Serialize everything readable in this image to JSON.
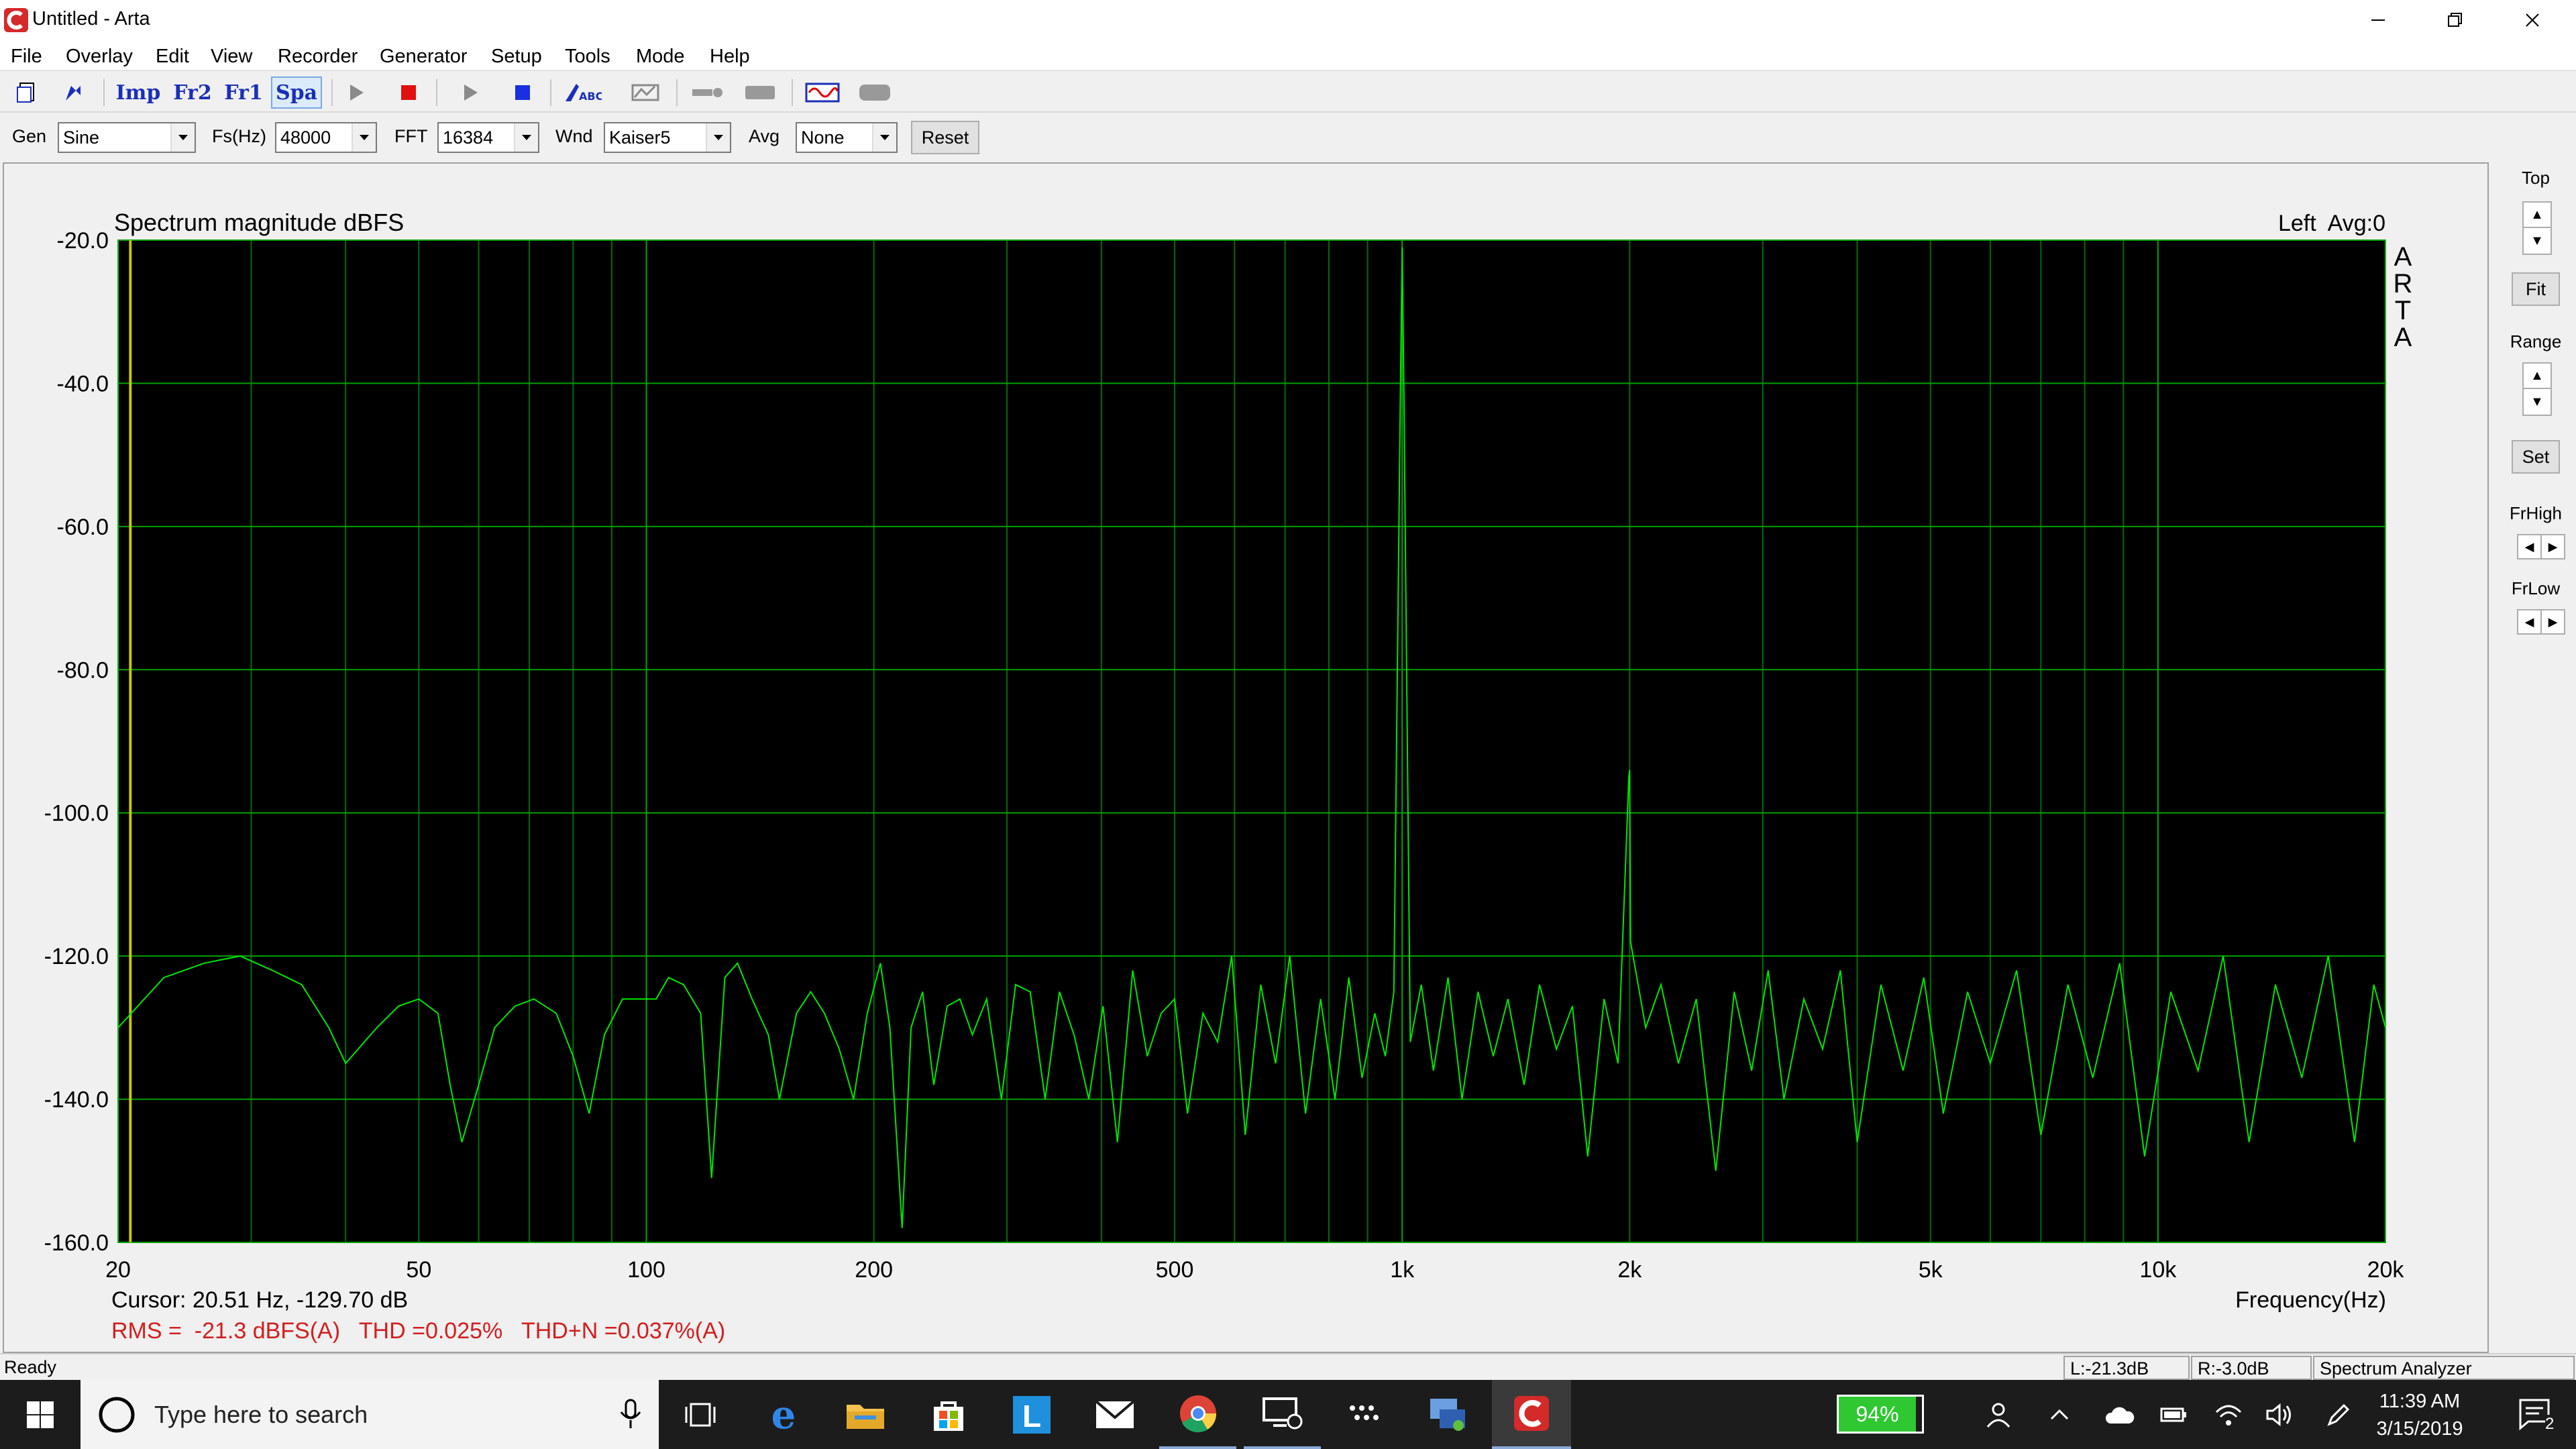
{
  "window": {
    "title": "Untitled - Arta"
  },
  "menu": [
    "File",
    "Overlay",
    "Edit",
    "View",
    "Recorder",
    "Generator",
    "Setup",
    "Tools",
    "Mode",
    "Help"
  ],
  "toolbar": {
    "imp": "Imp",
    "fr2": "Fr2",
    "fr1": "Fr1",
    "spa": "Spa"
  },
  "controls": {
    "gen_label": "Gen",
    "gen_value": "Sine",
    "fs_label": "Fs(Hz)",
    "fs_value": "48000",
    "fft_label": "FFT",
    "fft_value": "16384",
    "wnd_label": "Wnd",
    "wnd_value": "Kaiser5",
    "avg_label": "Avg",
    "avg_value": "None",
    "reset_label": "Reset"
  },
  "side": {
    "top": "Top",
    "fit": "Fit",
    "range": "Range",
    "set": "Set",
    "frhigh": "FrHigh",
    "frlow": "FrLow"
  },
  "plot": {
    "title": "Spectrum magnitude dBFS",
    "channel_info": "Left  Avg:0",
    "brand": [
      "A",
      "R",
      "T",
      "A"
    ],
    "cursor": "Cursor: 20.51 Hz, -129.70 dB",
    "stats": "RMS =  -21.3 dBFS(A)   THD =0.025%   THD+N =0.037%(A)",
    "xlabel": "Frequency(Hz)"
  },
  "chart_data": {
    "type": "line",
    "title": "Spectrum magnitude dBFS",
    "xlabel": "Frequency(Hz)",
    "ylabel": "",
    "x_scale": "log",
    "xlim": [
      20,
      20000
    ],
    "ylim": [
      -160,
      -20
    ],
    "grid": true,
    "x_ticks": [
      20,
      50,
      100,
      200,
      500,
      1000,
      2000,
      5000,
      10000,
      20000
    ],
    "x_tick_labels": [
      "20",
      "50",
      "100",
      "200",
      "500",
      "1k",
      "2k",
      "5k",
      "10k",
      "20k"
    ],
    "y_ticks": [
      -20,
      -40,
      -60,
      -80,
      -100,
      -120,
      -140,
      -160
    ],
    "y_tick_labels": [
      "-20.0",
      "-40.0",
      "-60.0",
      "-80.0",
      "-100.0",
      "-120.0",
      "-140.0",
      "-160.0"
    ],
    "series": [
      {
        "color": "#00e600",
        "points": [
          [
            20,
            -130
          ],
          [
            23,
            -123
          ],
          [
            26,
            -121
          ],
          [
            29,
            -120
          ],
          [
            32,
            -122
          ],
          [
            35,
            -124
          ],
          [
            38,
            -130
          ],
          [
            40,
            -135
          ],
          [
            44,
            -130
          ],
          [
            47,
            -127
          ],
          [
            50,
            -126
          ],
          [
            53,
            -128
          ],
          [
            55,
            -138
          ],
          [
            57,
            -146
          ],
          [
            60,
            -138
          ],
          [
            63,
            -130
          ],
          [
            67,
            -127
          ],
          [
            71,
            -126
          ],
          [
            76,
            -128
          ],
          [
            80,
            -134
          ],
          [
            84,
            -142
          ],
          [
            88,
            -131
          ],
          [
            93,
            -126
          ],
          [
            98,
            -126
          ],
          [
            103,
            -126
          ],
          [
            107,
            -123
          ],
          [
            112,
            -124
          ],
          [
            118,
            -128
          ],
          [
            122,
            -151
          ],
          [
            127,
            -123
          ],
          [
            132,
            -121
          ],
          [
            138,
            -126
          ],
          [
            145,
            -131
          ],
          [
            150,
            -140
          ],
          [
            158,
            -128
          ],
          [
            165,
            -125
          ],
          [
            172,
            -128
          ],
          [
            180,
            -133
          ],
          [
            188,
            -140
          ],
          [
            196,
            -128
          ],
          [
            204,
            -121
          ],
          [
            210,
            -130
          ],
          [
            218,
            -158
          ],
          [
            224,
            -130
          ],
          [
            232,
            -125
          ],
          [
            240,
            -138
          ],
          [
            250,
            -127
          ],
          [
            260,
            -126
          ],
          [
            270,
            -131
          ],
          [
            282,
            -126
          ],
          [
            295,
            -140
          ],
          [
            308,
            -124
          ],
          [
            322,
            -125
          ],
          [
            337,
            -140
          ],
          [
            352,
            -125
          ],
          [
            368,
            -131
          ],
          [
            385,
            -140
          ],
          [
            402,
            -127
          ],
          [
            420,
            -146
          ],
          [
            440,
            -122
          ],
          [
            460,
            -134
          ],
          [
            480,
            -128
          ],
          [
            500,
            -126
          ],
          [
            520,
            -142
          ],
          [
            545,
            -128
          ],
          [
            570,
            -132
          ],
          [
            595,
            -120
          ],
          [
            620,
            -145
          ],
          [
            650,
            -124
          ],
          [
            680,
            -135
          ],
          [
            710,
            -120
          ],
          [
            745,
            -142
          ],
          [
            780,
            -126
          ],
          [
            815,
            -140
          ],
          [
            850,
            -123
          ],
          [
            885,
            -137
          ],
          [
            920,
            -128
          ],
          [
            950,
            -134
          ],
          [
            975,
            -125
          ],
          [
            995,
            -40
          ],
          [
            1000,
            -21
          ],
          [
            1005,
            -40
          ],
          [
            1025,
            -132
          ],
          [
            1060,
            -124
          ],
          [
            1100,
            -136
          ],
          [
            1150,
            -123
          ],
          [
            1200,
            -140
          ],
          [
            1260,
            -125
          ],
          [
            1320,
            -134
          ],
          [
            1380,
            -126
          ],
          [
            1450,
            -138
          ],
          [
            1520,
            -124
          ],
          [
            1600,
            -133
          ],
          [
            1680,
            -127
          ],
          [
            1760,
            -148
          ],
          [
            1850,
            -126
          ],
          [
            1930,
            -135
          ],
          [
            1995,
            -95
          ],
          [
            2000,
            -94
          ],
          [
            2005,
            -118
          ],
          [
            2100,
            -130
          ],
          [
            2200,
            -124
          ],
          [
            2320,
            -135
          ],
          [
            2450,
            -126
          ],
          [
            2600,
            -150
          ],
          [
            2750,
            -125
          ],
          [
            2900,
            -136
          ],
          [
            3050,
            -122
          ],
          [
            3200,
            -140
          ],
          [
            3400,
            -126
          ],
          [
            3600,
            -133
          ],
          [
            3800,
            -122
          ],
          [
            4000,
            -146
          ],
          [
            4300,
            -124
          ],
          [
            4600,
            -136
          ],
          [
            4900,
            -123
          ],
          [
            5200,
            -142
          ],
          [
            5600,
            -125
          ],
          [
            6000,
            -135
          ],
          [
            6500,
            -122
          ],
          [
            7000,
            -145
          ],
          [
            7600,
            -124
          ],
          [
            8200,
            -137
          ],
          [
            8900,
            -121
          ],
          [
            9600,
            -148
          ],
          [
            10400,
            -125
          ],
          [
            11300,
            -136
          ],
          [
            12200,
            -120
          ],
          [
            13200,
            -146
          ],
          [
            14300,
            -124
          ],
          [
            15500,
            -137
          ],
          [
            16800,
            -120
          ],
          [
            18200,
            -146
          ],
          [
            19300,
            -124
          ],
          [
            20000,
            -130
          ]
        ]
      }
    ]
  },
  "status": {
    "ready": "Ready",
    "left": "L:-21.3dB",
    "right": "R:-3.0dB",
    "mode": "Spectrum Analyzer"
  },
  "taskbar": {
    "search_placeholder": "Type here to search",
    "battery": "94%",
    "time": "11:39 AM",
    "date": "3/15/2019",
    "notifications": "2"
  }
}
